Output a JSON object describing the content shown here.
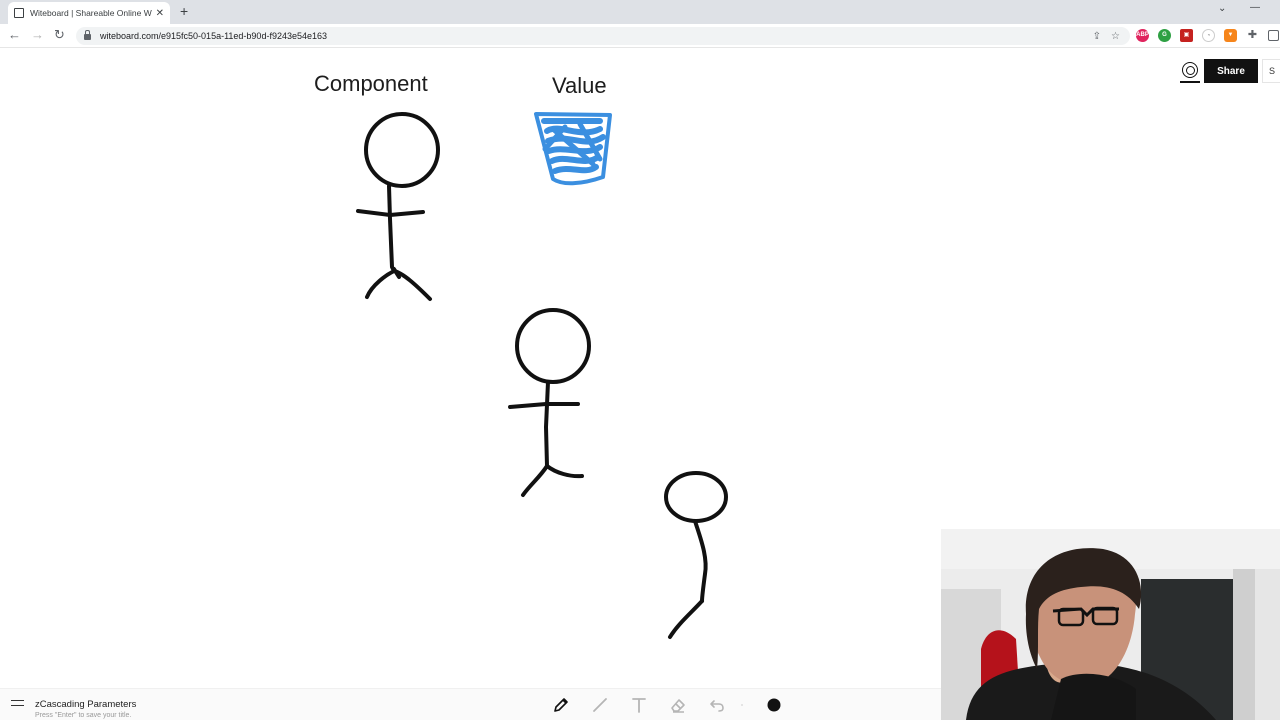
{
  "browser": {
    "tab_title": "Witeboard | Shareable Online W",
    "url": "witeboard.com/e915fc50-015a-11ed-b90d-f9243e54e163"
  },
  "board": {
    "label_component": "Component",
    "label_value": "Value",
    "share_label": "Share",
    "cut_label": "S",
    "title": "zCascading Parameters",
    "hint": "Press \"Enter\" to save your title."
  },
  "colors": {
    "ink": "#111111",
    "marker_blue": "#3b8fe0",
    "share_bg": "#111111"
  }
}
